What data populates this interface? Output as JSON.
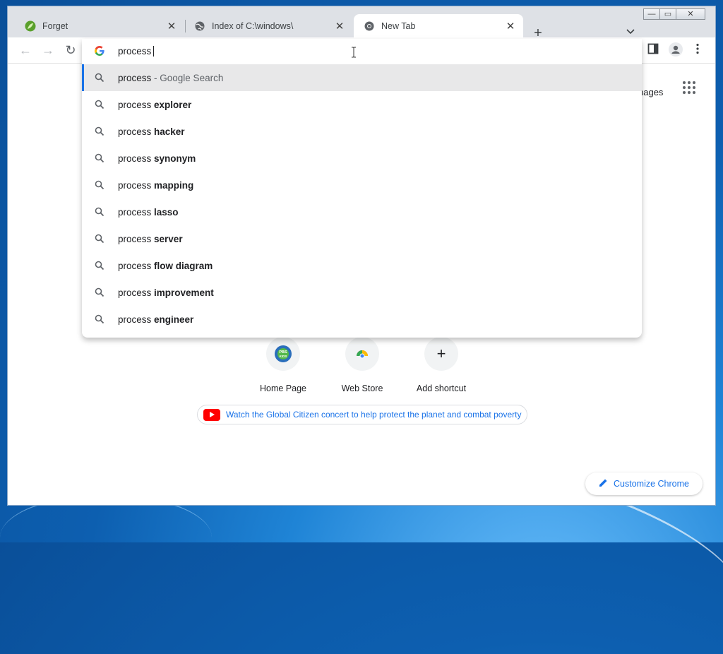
{
  "tabs": [
    {
      "title": "Forget",
      "icon": "leaf-icon",
      "close": "✕"
    },
    {
      "title": "Index of C:\\windows\\",
      "icon": "globe-icon",
      "close": "✕"
    },
    {
      "title": "New Tab",
      "icon": "chrome-icon",
      "close": "✕"
    }
  ],
  "new_tab_symbol": "+",
  "tab_search_symbol": "⌄",
  "window_controls": {
    "minimize": "—",
    "maximize": "▭",
    "close": "✕"
  },
  "nav": {
    "back": "←",
    "forward": "→",
    "reload": "↻"
  },
  "omnibox": {
    "value": "process",
    "suggestions": [
      {
        "prefix": "process",
        "bold": "",
        "desc": " - Google Search",
        "selected": true
      },
      {
        "prefix": "process ",
        "bold": "explorer"
      },
      {
        "prefix": "process ",
        "bold": "hacker"
      },
      {
        "prefix": "process ",
        "bold": "synonym"
      },
      {
        "prefix": "process ",
        "bold": "mapping"
      },
      {
        "prefix": "process ",
        "bold": "lasso"
      },
      {
        "prefix": "process ",
        "bold": "server"
      },
      {
        "prefix": "process ",
        "bold": "flow diagram"
      },
      {
        "prefix": "process ",
        "bold": "improvement"
      },
      {
        "prefix": "process ",
        "bold": "engineer"
      }
    ]
  },
  "newtab": {
    "images_link": "nages",
    "shortcuts": [
      {
        "label": "Home Page",
        "icon": "pbs-kids-icon",
        "icon_text": "PBS KIDS"
      },
      {
        "label": "Web Store",
        "icon": "chrome-webstore-icon"
      },
      {
        "label": "Add shortcut",
        "icon": "plus-icon",
        "icon_text": "+"
      }
    ],
    "promo_text": "Watch the Global Citizen concert to help protect the planet and combat poverty",
    "customize_label": "Customize Chrome"
  },
  "colors": {
    "accent": "#1a73e8",
    "youtube": "#ff0000"
  }
}
